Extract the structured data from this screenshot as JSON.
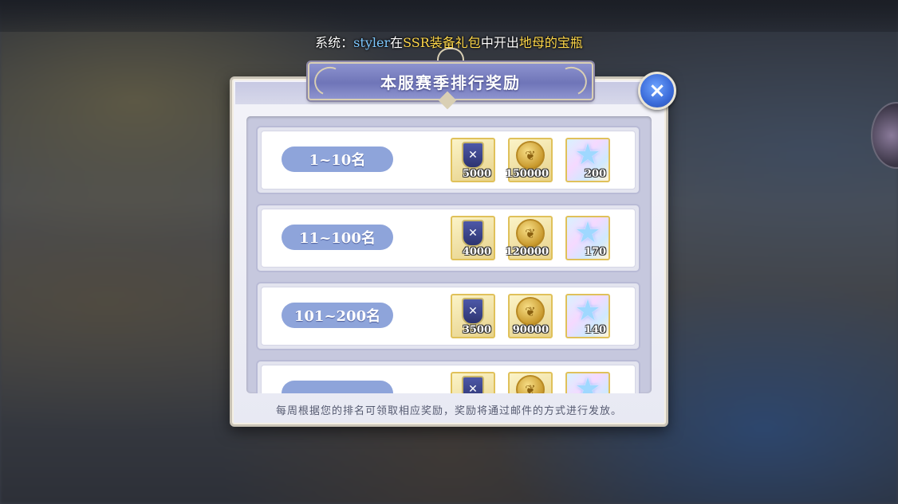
{
  "broadcast": {
    "prefix": "系统：",
    "player": "styler",
    "in": "在",
    "pack": "SSR装备礼包",
    "middle": "中开出",
    "item": "地母的宝瓶"
  },
  "dialog": {
    "title": "本服赛季排行奖励",
    "close_icon": "×",
    "footer": "每周根据您的排名可领取相应奖励，奖励将通过邮件的方式进行发放。"
  },
  "rows": [
    {
      "rank": "1~10名",
      "rewards": [
        {
          "icon": "shield-badge-icon",
          "qty": "5000"
        },
        {
          "icon": "gold-coin-icon",
          "qty": "150000"
        },
        {
          "icon": "crystal-star-icon",
          "qty": "200"
        }
      ]
    },
    {
      "rank": "11~100名",
      "rewards": [
        {
          "icon": "shield-badge-icon",
          "qty": "4000"
        },
        {
          "icon": "gold-coin-icon",
          "qty": "120000"
        },
        {
          "icon": "crystal-star-icon",
          "qty": "170"
        }
      ]
    },
    {
      "rank": "101~200名",
      "rewards": [
        {
          "icon": "shield-badge-icon",
          "qty": "3500"
        },
        {
          "icon": "gold-coin-icon",
          "qty": "90000"
        },
        {
          "icon": "crystal-star-icon",
          "qty": "140"
        }
      ]
    },
    {
      "rank": "",
      "rewards": [
        {
          "icon": "shield-badge-icon",
          "qty": ""
        },
        {
          "icon": "gold-coin-icon",
          "qty": ""
        },
        {
          "icon": "crystal-star-icon",
          "qty": ""
        }
      ]
    }
  ],
  "colors": {
    "broadcast_name": "#7ec8ff",
    "broadcast_highlight": "#ffd84a",
    "title_banner": "#7a80c2",
    "rank_pill": "#8ea4da",
    "close_button": "#3a6ad8"
  }
}
